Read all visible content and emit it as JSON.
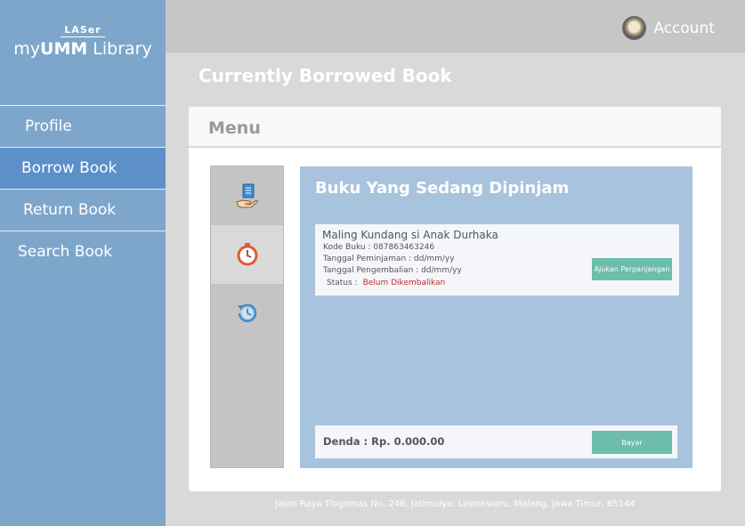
{
  "brand": {
    "top": "LASer",
    "main_prefix": "my",
    "main_bold": "UMM",
    "main_suffix": " Library"
  },
  "sidebar": {
    "items": [
      {
        "label": "Profile"
      },
      {
        "label": "Borrow Book"
      },
      {
        "label": "Return Book"
      },
      {
        "label": "Search Book"
      }
    ]
  },
  "header": {
    "account_label": "Account",
    "avatar_icon": "user-avatar"
  },
  "page": {
    "title": "Currently Borrowed Book"
  },
  "menu": {
    "title": "Menu",
    "icons": [
      "book-hand-icon",
      "stopwatch-icon",
      "history-icon"
    ]
  },
  "panel": {
    "title": "Buku Yang Sedang Dipinjam",
    "book": {
      "title": "Maling Kundang si Anak Durhaka",
      "code": "Kode Buku : 087863463246",
      "borrow_date": "Tanggal Peminjaman : dd/mm/yy",
      "return_date": "Tanggal Pengembalian : dd/mm/yy",
      "status_label": "Status :",
      "status_value": "Belum Dikembalikan",
      "extend_button": "Ajukan Perpanjangan"
    },
    "fine": {
      "label": "Denda : Rp. 0.000.00",
      "pay_button": "Bayar"
    }
  },
  "footer": {
    "address": "Jalan Raya Tlogomas No. 246, Jatimulyo, Lowokwaru, Malang, Jawa Timur, 65144"
  },
  "colors": {
    "sidebar": "#7ea6cb",
    "sidebar_active": "#5d8fc9",
    "panel": "#a8c3dd",
    "button": "#6cbdab",
    "status": "#c02929"
  }
}
